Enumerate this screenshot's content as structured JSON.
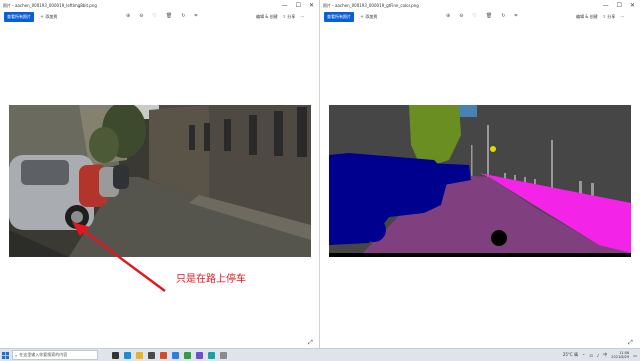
{
  "left_window": {
    "title": "照片 - aachen_000193_000019_leftImg8bit.png",
    "primary_button": "查看所有照片",
    "add_link": "添加到",
    "edit_label": "编辑 & 创建",
    "share_label": "分享",
    "annotation_text": "只是在路上停车"
  },
  "right_window": {
    "title": "照片 - aachen_000193_000019_gtFine_color.png",
    "primary_button": "查看所有照片",
    "add_link": "添加到",
    "edit_label": "编辑 & 创建",
    "share_label": "分享"
  },
  "window_controls": {
    "minimize": "—",
    "maximize": "☐",
    "close": "✕"
  },
  "taskbar": {
    "search_placeholder": "在这里输入你要搜索的内容",
    "weather": "25°C 晴",
    "ime": "中",
    "time": "11:56",
    "date": "2021/8/29"
  },
  "colors": {
    "accent": "#0a5fd6",
    "annotation": "#e4161d",
    "seg_road": "#804080",
    "seg_sidewalk": "#f423e8",
    "seg_building": "#464646",
    "seg_vegetation": "#6b8e23",
    "seg_car": "#00008e",
    "seg_sky": "#4682b4",
    "seg_pole": "#999999"
  },
  "icons": [
    "zoom-in-icon",
    "zoom-out-icon",
    "favorite-icon",
    "delete-icon",
    "rotate-icon",
    "crop-icon",
    "share-icon",
    "more-icon",
    "fullscreen-icon",
    "search-icon",
    "windows-icon"
  ]
}
